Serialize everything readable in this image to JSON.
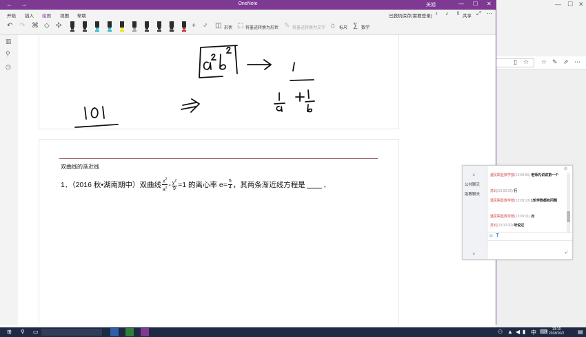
{
  "window": {
    "title": "OneNote",
    "user": "关旭",
    "sync_status": "已脱机保存(需要登录)",
    "share_label": "共享"
  },
  "menu": {
    "tabs": [
      "开始",
      "插入",
      "绘图",
      "视图",
      "帮助"
    ],
    "active_tab": "绘图"
  },
  "toolbar": {
    "shapes_label": "形状",
    "ink_to_shape_label": "将墨迹转换为形状",
    "ink_to_text_label": "将墨迹转换为文字",
    "ruler_label": "标尺",
    "math_label": "数学",
    "pen_colors": [
      "#2b2b2b",
      "#2b2b2b",
      "#2ab3c6",
      "#2ab3c6",
      "#f2e200",
      "#9a9a9a",
      "#2b2b2b",
      "#2b2b2b",
      "#2b2b2b",
      "#c62828"
    ]
  },
  "sidebar_icons": [
    "notebooks-icon",
    "search-icon",
    "recent-icon"
  ],
  "note": {
    "section_title": "双曲线的渐近线",
    "question": {
      "prefix": "1．（2016 秋•湖南期中）双曲线",
      "frac1_num": "x",
      "frac1_num_sup": "2",
      "frac1_den": "a",
      "frac1_den_sup": "2",
      "minus": "-",
      "frac2_num": "y",
      "frac2_num_sup": "2",
      "frac2_den": "9",
      "eq": "=1 的离心率 e=",
      "frac3_num": "5",
      "frac3_den": "4",
      "suffix": "，其两条渐近线方程是",
      "end": "．"
    }
  },
  "chat": {
    "tabs": [
      "公共聊天",
      "助教聊天"
    ],
    "messages": [
      {
        "who": "遇见瞬显数学部",
        "time": "(13:09:56)",
        "text": "老师先讲讲第一个"
      },
      {
        "who": "苏北",
        "time": "(13:09:02)",
        "text": "行"
      },
      {
        "who": "遇见瞬显数学部",
        "time": "(13:09:10)",
        "text": "1轮学数都有问题"
      },
      {
        "who": "遇见瞬显数学部",
        "time": "(13:09:31)",
        "text": "对"
      },
      {
        "who": "苏北",
        "time": "(13:10:20)",
        "text": "听说过"
      }
    ]
  },
  "taskbar": {
    "time": "13:10",
    "date": "2018/10/2",
    "ime": "中"
  },
  "colors": {
    "brand": "#7e3a93",
    "taskbar": "#1c2a44"
  }
}
